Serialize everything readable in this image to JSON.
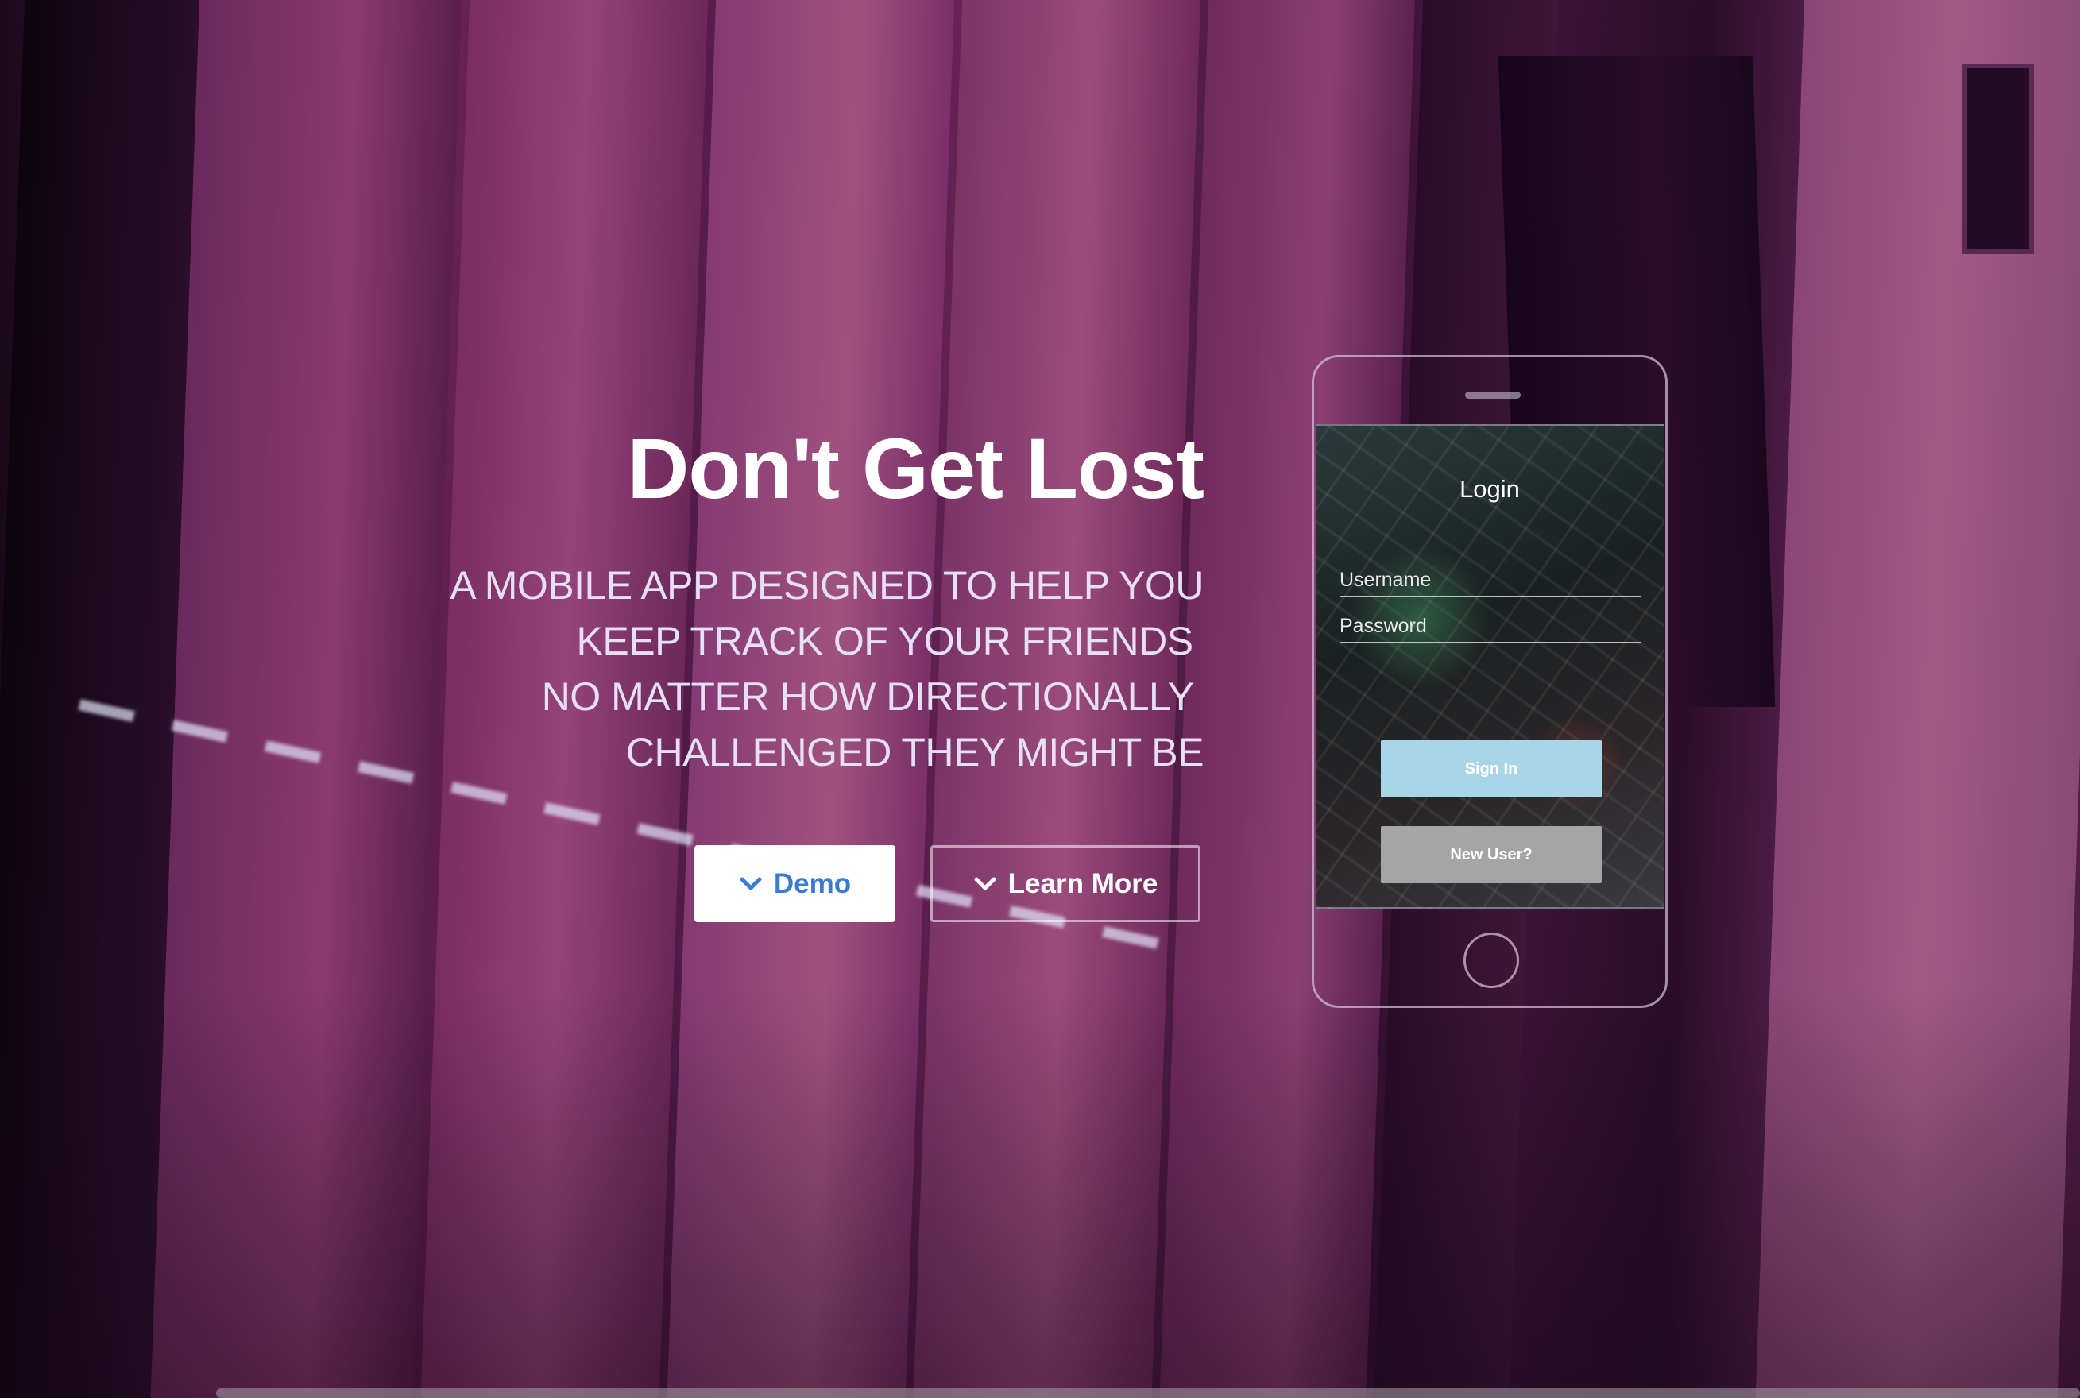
{
  "hero": {
    "title": "Don't Get Lost",
    "subtitle_lines": [
      "A MOBILE APP DESIGNED TO HELP YOU",
      "KEEP TRACK OF YOUR FRIENDS ",
      "NO MATTER HOW DIRECTIONALLY ",
      "CHALLENGED THEY MIGHT BE"
    ],
    "buttons": {
      "demo_label": "Demo",
      "learn_more_label": "Learn More",
      "icon": "chevron-down-icon"
    }
  },
  "phone_mockup": {
    "login_title": "Login",
    "username_placeholder": "Username",
    "password_placeholder": "Password",
    "sign_in_label": "Sign In",
    "new_user_label": "New User?"
  },
  "colors": {
    "demo_text": "#3a7bd5",
    "sign_in_bg": "#a9d6e6",
    "new_user_bg": "#a5a5a5",
    "background_tint": "#6d2558"
  }
}
